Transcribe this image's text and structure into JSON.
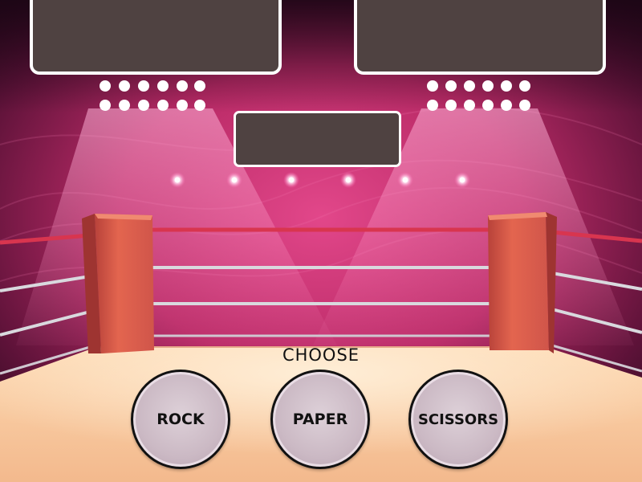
{
  "scoreboard": {
    "left_value": "",
    "right_value": "",
    "result_text": ""
  },
  "controls": {
    "prompt": "CHOOSE",
    "rock_label": "ROCK",
    "paper_label": "PAPER",
    "scissors_label": "SCISSORS"
  },
  "colors": {
    "background_top": "#2a0d22",
    "background_mid": "#c4326e",
    "panel_fill": "#4f4241",
    "panel_border": "#ffffff",
    "rope_red": "#d8354f",
    "rope_white": "#d9d9de",
    "corner_post": "#e0614f",
    "floor": "#f9cfa3",
    "button_fill": "#cbb9c4"
  }
}
